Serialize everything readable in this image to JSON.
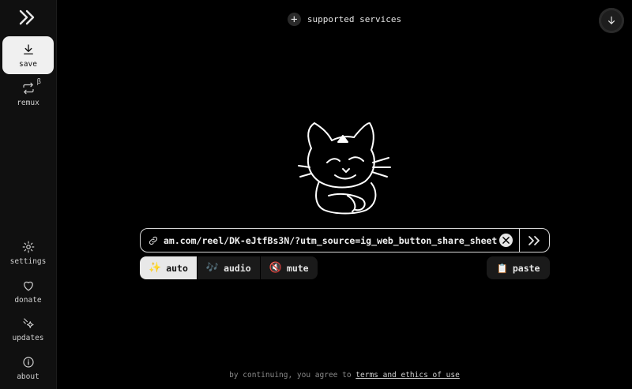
{
  "sidebar": {
    "logo": ">>",
    "items": [
      {
        "label": "save",
        "icon": "download-icon",
        "active": true
      },
      {
        "label": "remux",
        "icon": "remux-icon",
        "badge": "β"
      },
      {
        "label": "settings",
        "icon": "gear-icon"
      },
      {
        "label": "donate",
        "icon": "heart-icon"
      },
      {
        "label": "updates",
        "icon": "sparkle-icon"
      },
      {
        "label": "about",
        "icon": "info-icon"
      }
    ]
  },
  "header": {
    "services_label": "supported services"
  },
  "input": {
    "url": "am.com/reel/DK-eJtfBs3N/?utm_source=ig_web_button_share_sheet"
  },
  "modes": [
    {
      "label": "auto",
      "emoji": "✨",
      "active": true
    },
    {
      "label": "audio",
      "emoji": "🎶"
    },
    {
      "label": "mute",
      "emoji": "🔇"
    }
  ],
  "paste_label": "paste",
  "paste_emoji": "📋",
  "footer": {
    "prefix": "by continuing, you agree to",
    "link": "terms and ethics of use"
  },
  "colors": {
    "background": "#000000",
    "sidebar": "#101010",
    "active": "#f0f0f0"
  }
}
